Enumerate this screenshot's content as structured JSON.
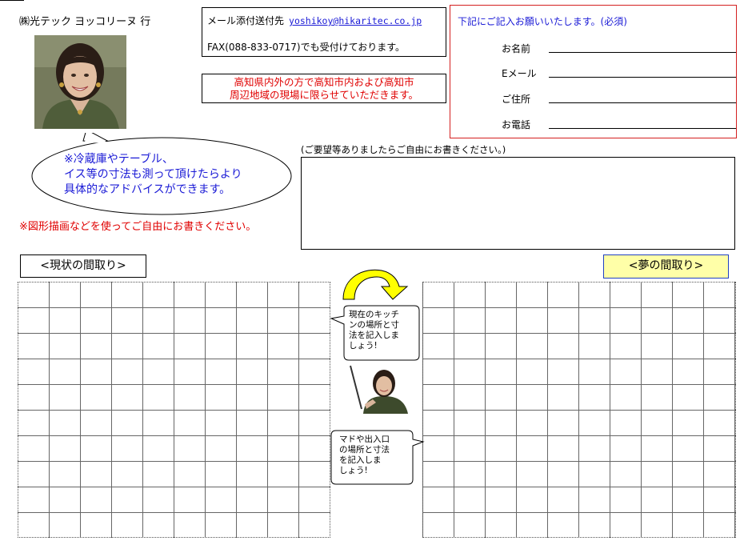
{
  "header": {
    "addressee": "㈱光テック ヨッコリーヌ 行"
  },
  "contact": {
    "mail_label": "メール添付送付先",
    "email": "yoshikoy@hikaritec.co.jp",
    "fax": "FAX(088-833-0717)でも受付けております。"
  },
  "area_notice": {
    "line1": "高知県内外の方で高知市内および高知市",
    "line2": "周辺地域の現場に限らせていただきます。"
  },
  "form": {
    "title": "下記にご記入お願いいたします。(必須)",
    "fields": [
      {
        "label": "お名前"
      },
      {
        "label": "Eメール"
      },
      {
        "label": "ご住所"
      },
      {
        "label": "お電話"
      }
    ]
  },
  "speech": {
    "line1": "※冷蔵庫やテーブル、",
    "line2": "イス等の寸法も測って頂けたらより",
    "line3": "具体的なアドバイスができます。"
  },
  "draw_note": "※図形描画などを使ってご自由にお書きください。",
  "request": {
    "label": "(ご要望等ありましたらご自由にお書きください。)"
  },
  "layouts": {
    "current_label": "<現状の間取り>",
    "dream_label": "<夢の間取り>"
  },
  "callouts": {
    "kitchen": [
      "現在のキッチ",
      "ンの場所と寸",
      "法を記入しま",
      "しょう!"
    ],
    "window": [
      "マドや出入口",
      "の場所と寸法",
      "を記入しま",
      "しょう!"
    ]
  },
  "colors": {
    "blue_text": "#1a1ad6",
    "red_text": "#e00000",
    "form_border": "#d42020",
    "dream_bg": "#ffffa8",
    "arrow_fill": "#ffff00"
  }
}
